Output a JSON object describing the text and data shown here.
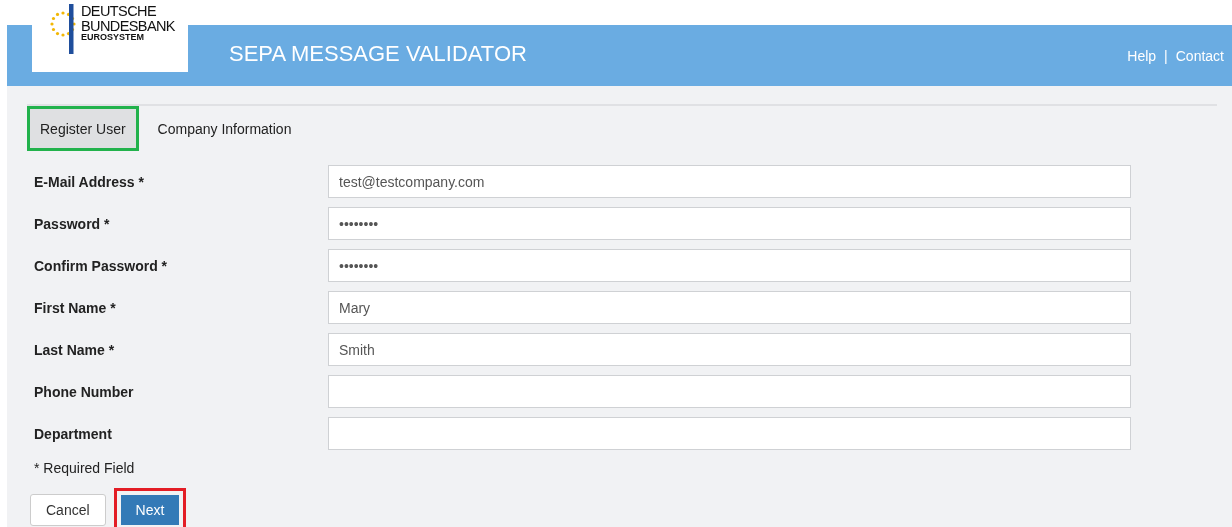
{
  "logo": {
    "line_1": "DEUTSCHE",
    "line_2": "BUNDESBANK",
    "line_3": "EUROSYSTEM"
  },
  "header": {
    "title": "SEPA MESSAGE VALIDATOR",
    "links": [
      "Help",
      "Contact"
    ],
    "separator": "|"
  },
  "tabs": [
    {
      "label": "Register User",
      "selected": true,
      "highlighted": true
    },
    {
      "label": "Company Information",
      "selected": false,
      "highlighted": false
    }
  ],
  "fields": [
    {
      "label": "E-Mail Address *",
      "value": "test@testcompany.com"
    },
    {
      "label": "Password *",
      "value": "••••••••"
    },
    {
      "label": "Confirm Password *",
      "value": "••••••••"
    },
    {
      "label": "First Name *",
      "value": "Mary"
    },
    {
      "label": "Last Name *",
      "value": "Smith"
    },
    {
      "label": "Phone Number"
    },
    {
      "label": "Department"
    }
  ],
  "note": "* Required Field",
  "buttons": [
    {
      "label": "Cancel",
      "kind": "default",
      "highlighted": false
    },
    {
      "label": "Next",
      "kind": "primary",
      "highlighted": true
    }
  ]
}
